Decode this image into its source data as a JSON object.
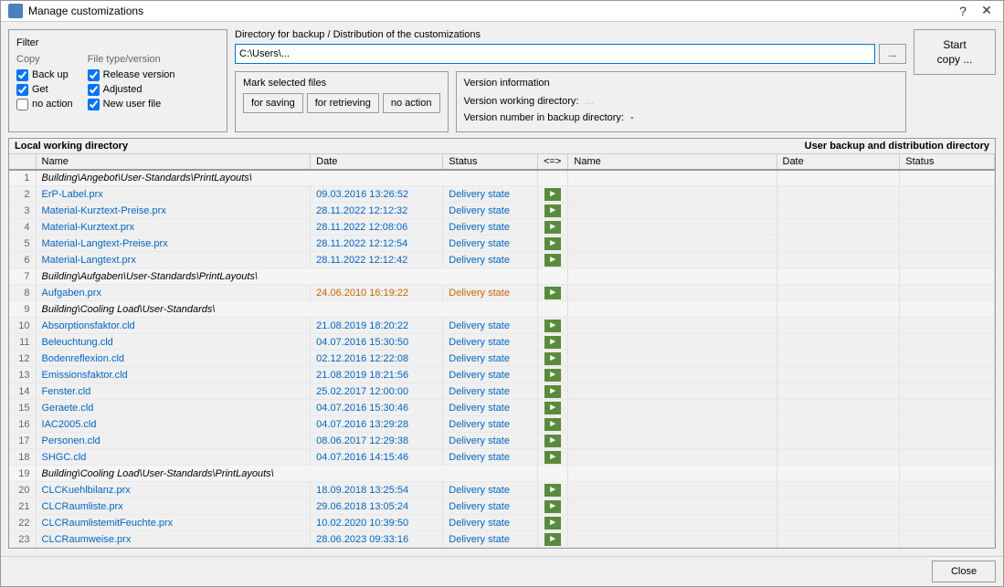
{
  "window": {
    "title": "Manage customizations",
    "help_label": "?",
    "close_label": "✕"
  },
  "filter": {
    "title": "Filter",
    "copy_title": "Copy",
    "filetype_title": "File type/version",
    "backup_label": "Back up",
    "get_label": "Get",
    "no_action_label": "no action",
    "release_label": "Release version",
    "adjusted_label": "Adjusted",
    "new_user_label": "New user file"
  },
  "directory": {
    "title": "Directory for backup / Distribution of the customizations",
    "value": "C:\\Users\\...",
    "browse_label": "..."
  },
  "mark_files": {
    "title": "Mark selected files",
    "for_saving_label": "for saving",
    "for_retrieving_label": "for retrieving",
    "no_action_label": "no action"
  },
  "version_info": {
    "title": "Version information",
    "working_dir_label": "Version working directory:",
    "working_dir_value": "...",
    "backup_dir_label": "Version number in backup directory:",
    "backup_dir_value": "-"
  },
  "start_btn_label": "Start\ncopy ...",
  "local_section_title": "Local working directory",
  "user_section_title": "User backup and distribution directory",
  "table_headers_local": [
    "",
    "Name",
    "Date",
    "Status",
    "<=>"
  ],
  "table_headers_user": [
    "Name",
    "Date",
    "Status"
  ],
  "rows": [
    {
      "num": 1,
      "name": "Building\\Angebot\\User-Standards\\PrintLayouts\\",
      "date": "",
      "status": "",
      "arrow": false,
      "is_header": true
    },
    {
      "num": 2,
      "name": "ErP-Label.prx",
      "date": "09.03.2016 13:26:52",
      "status": "Delivery state",
      "arrow": true,
      "is_link": true
    },
    {
      "num": 3,
      "name": "Material-Kurztext-Preise.prx",
      "date": "28.11.2022 12:12:32",
      "status": "Delivery state",
      "arrow": true,
      "is_link": true
    },
    {
      "num": 4,
      "name": "Material-Kurztext.prx",
      "date": "28.11.2022 12:08:06",
      "status": "Delivery state",
      "arrow": true,
      "is_link": true
    },
    {
      "num": 5,
      "name": "Material-Langtext-Preise.prx",
      "date": "28.11.2022 12:12:54",
      "status": "Delivery state",
      "arrow": true,
      "is_link": true
    },
    {
      "num": 6,
      "name": "Material-Langtext.prx",
      "date": "28.11.2022 12:12:42",
      "status": "Delivery state",
      "arrow": true,
      "is_link": true
    },
    {
      "num": 7,
      "name": "Building\\Aufgaben\\User-Standards\\PrintLayouts\\",
      "date": "",
      "status": "",
      "arrow": false,
      "is_header": true
    },
    {
      "num": 8,
      "name": "Aufgaben.prx",
      "date": "24.06.2010 16:19:22",
      "status": "Delivery state",
      "arrow": true,
      "is_link": true,
      "date_orange": true
    },
    {
      "num": 9,
      "name": "Building\\Cooling Load\\User-Standards\\",
      "date": "",
      "status": "",
      "arrow": false,
      "is_header": true
    },
    {
      "num": 10,
      "name": "Absorptionsfaktor.cld",
      "date": "21.08.2019 18:20:22",
      "status": "Delivery state",
      "arrow": true,
      "is_link": true
    },
    {
      "num": 11,
      "name": "Beleuchtung.cld",
      "date": "04.07.2016 15:30:50",
      "status": "Delivery state",
      "arrow": true,
      "is_link": true
    },
    {
      "num": 12,
      "name": "Bodenreflexion.cld",
      "date": "02.12.2016 12:22:08",
      "status": "Delivery state",
      "arrow": true,
      "is_link": true
    },
    {
      "num": 13,
      "name": "Emissionsfaktor.cld",
      "date": "21.08.2019 18:21:56",
      "status": "Delivery state",
      "arrow": true,
      "is_link": true
    },
    {
      "num": 14,
      "name": "Fenster.cld",
      "date": "25.02.2017 12:00:00",
      "status": "Delivery state",
      "arrow": true,
      "is_link": true
    },
    {
      "num": 15,
      "name": "Geraete.cld",
      "date": "04.07.2016 15:30:46",
      "status": "Delivery state",
      "arrow": true,
      "is_link": true
    },
    {
      "num": 16,
      "name": "IAC2005.cld",
      "date": "04.07.2016 13:29:28",
      "status": "Delivery state",
      "arrow": true,
      "is_link": true
    },
    {
      "num": 17,
      "name": "Personen.cld",
      "date": "08.06.2017 12:29:38",
      "status": "Delivery state",
      "arrow": true,
      "is_link": true
    },
    {
      "num": 18,
      "name": "SHGC.cld",
      "date": "04.07.2016 14:15:46",
      "status": "Delivery state",
      "arrow": true,
      "is_link": true
    },
    {
      "num": 19,
      "name": "Building\\Cooling Load\\User-Standards\\PrintLayouts\\",
      "date": "",
      "status": "",
      "arrow": false,
      "is_header": true
    },
    {
      "num": 20,
      "name": "CLCKuehlbilanz.prx",
      "date": "18.09.2018 13:25:54",
      "status": "Delivery state",
      "arrow": true,
      "is_link": true
    },
    {
      "num": 21,
      "name": "CLCRaumliste.prx",
      "date": "29.06.2018 13:05:24",
      "status": "Delivery state",
      "arrow": true,
      "is_link": true
    },
    {
      "num": 22,
      "name": "CLCRaumlistemitFeuchte.prx",
      "date": "10.02.2020 10:39:50",
      "status": "Delivery state",
      "arrow": true,
      "is_link": true
    },
    {
      "num": 23,
      "name": "CLCRaumweise.prx",
      "date": "28.06.2023 09:33:16",
      "status": "Delivery state",
      "arrow": true,
      "is_link": true
    }
  ],
  "close_label": "Close"
}
